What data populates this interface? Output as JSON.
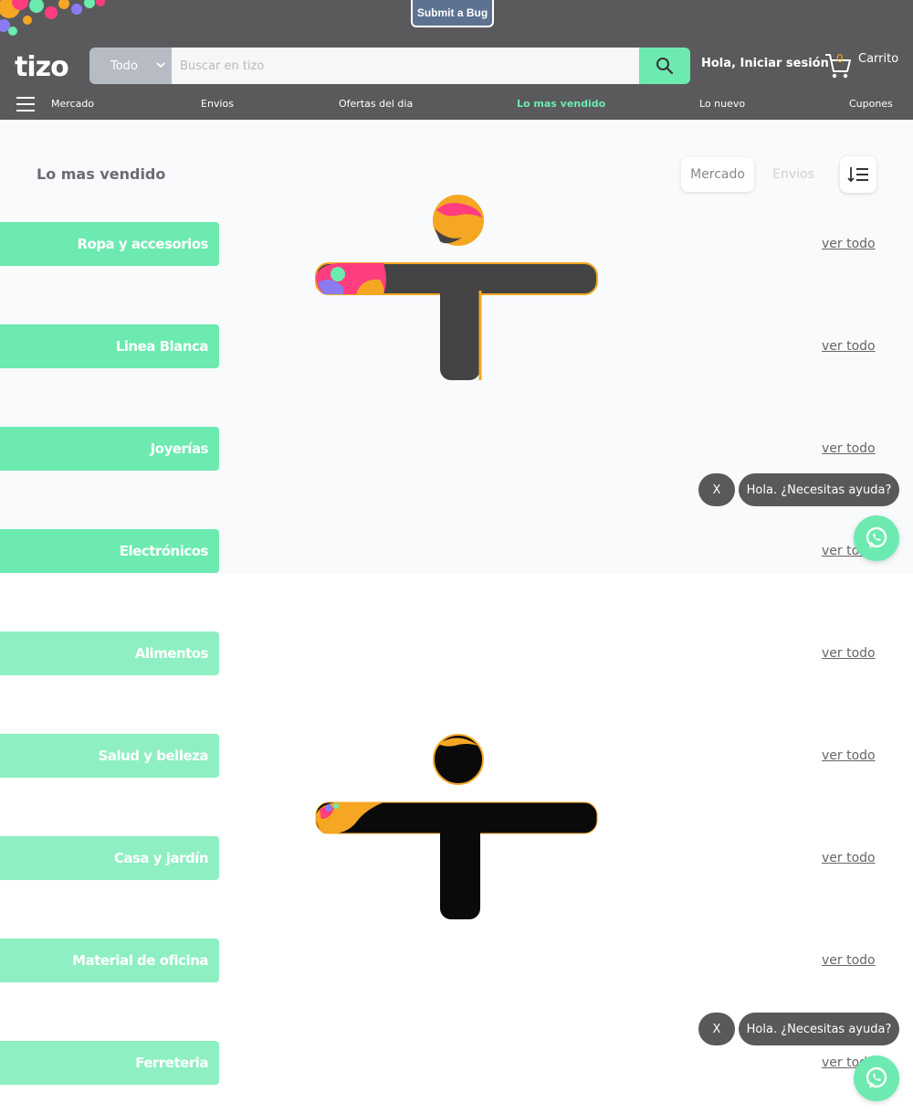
{
  "header": {
    "bug_button": "Submit a Bug",
    "logo_text": "tizo",
    "search": {
      "category": "Todo",
      "placeholder": "Buscar en tizo"
    },
    "login": "Hola, Iniciar sesión",
    "cart": {
      "count": "0",
      "label": "Carrito"
    },
    "nav": [
      "Mercado",
      "Envios",
      "Ofertas del dia",
      "Lo mas vendido",
      "Lo nuevo",
      "Cupones"
    ],
    "active_nav": "Lo mas vendido"
  },
  "main": {
    "title": "Lo mas vendido",
    "filters": [
      "Mercado",
      "Envios"
    ],
    "active_filter": "Mercado",
    "categories": [
      {
        "label": "Ropa y accesorios",
        "link": "ver todo"
      },
      {
        "label": "Linea Blanca",
        "link": "ver todo"
      },
      {
        "label": "Joyerías",
        "link": "ver todo"
      },
      {
        "label": "Electrónicos",
        "link": "ver todo"
      },
      {
        "label": "Alimentos",
        "link": "ver todo"
      },
      {
        "label": "Salud y belleza",
        "link": "ver todo"
      },
      {
        "label": "Casa y jardín",
        "link": "ver todo"
      },
      {
        "label": "Material de oficina",
        "link": "ver todo"
      },
      {
        "label": "Ferreteria",
        "link": "ver todo"
      }
    ]
  },
  "chat": {
    "close": "X",
    "message": "Hola. ¿Necesitas ayuda?"
  },
  "colors": {
    "header_bg": "#5a5a5c",
    "accent": "#6ceab0",
    "bug_button": "#5d7291",
    "cart_count": "#f5a623"
  },
  "icons": [
    "search-icon",
    "chevron-down-icon",
    "cart-icon",
    "hamburger-icon",
    "sort-icon",
    "whatsapp-icon",
    "tizo-loader-icon"
  ]
}
